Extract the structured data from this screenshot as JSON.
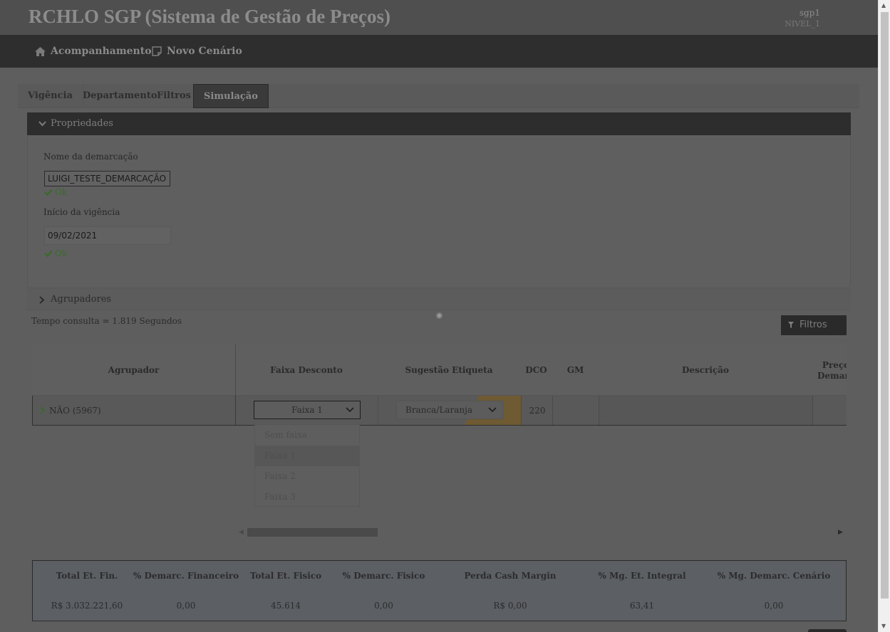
{
  "header": {
    "title": "RCHLO SGP (Sistema de Gestão de Preços)",
    "user": "sgp1",
    "level": "NIVEL_1"
  },
  "nav": {
    "items": [
      {
        "label": "Acompanhamento",
        "icon": "home-icon"
      },
      {
        "label": "Novo Cenário",
        "icon": "new-scenario-icon"
      }
    ]
  },
  "tabs": [
    {
      "label": "Vigência"
    },
    {
      "label": "Departamento"
    },
    {
      "label": "Filtros"
    },
    {
      "label": "Simulação",
      "active": true
    }
  ],
  "properties": {
    "title": "Propriedades",
    "name_label": "Nome da demarcação",
    "name_value": "LUIGI_TESTE_DEMARCAÇÃO",
    "name_ok": "Ok",
    "start_label": "Início da vigência",
    "start_value": "09/02/2021",
    "start_ok": "Ok"
  },
  "agrupadores": {
    "title": "Agrupadores"
  },
  "query_time": "Tempo consulta = 1.819 Segundos",
  "filters_button": "Filtros",
  "grid": {
    "columns": [
      {
        "label": "Agrupador"
      },
      {
        "label": "Faixa Desconto"
      },
      {
        "label": "Sugestão Etiqueta"
      },
      {
        "label": "DCO"
      },
      {
        "label": "GM"
      },
      {
        "label": "Descrição"
      },
      {
        "label": "Preço Demarc."
      }
    ],
    "row": {
      "agrupador": "NÃO (5967)",
      "faixa": "Faixa 1",
      "etiqueta": "Branca/Laranja",
      "dco": "220",
      "gm": "",
      "descricao": "",
      "preco": ""
    }
  },
  "dropdown": {
    "options": [
      "Sem faixa",
      "Faixa 1",
      "Faixa 2",
      "Faixa 3"
    ],
    "selected": "Faixa 1"
  },
  "summary": {
    "headers": [
      "Total Et. Fin.",
      "% Demarc. Financeiro",
      "Total Et. Fisico",
      "% Demarc. Fisico",
      "Perda Cash Margin",
      "% Mg. Et. Integral",
      "% Mg. Demarc. Cenário"
    ],
    "values": [
      "R$ 3.032.221,60",
      "0,00",
      "45.614",
      "0,00",
      "R$ 0,00",
      "63,41",
      "0,00"
    ]
  },
  "colors": {
    "overlay_bg": "#5e5e5e",
    "navbar": "#2e2e2e",
    "ok_green": "#3b6a2b",
    "etiqueta_orange": "#6e5a33"
  }
}
